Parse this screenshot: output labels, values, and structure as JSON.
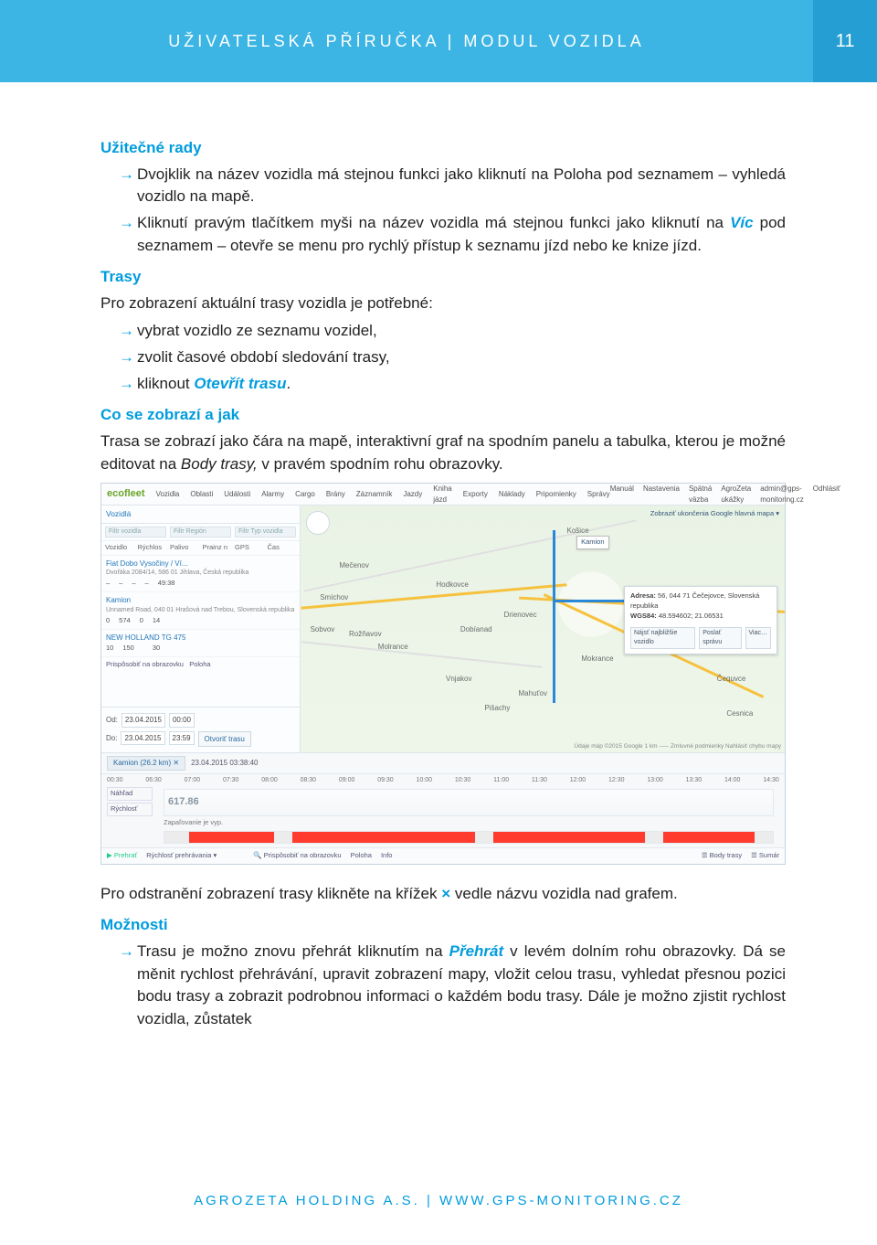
{
  "header": {
    "title": "UŽIVATELSKÁ PŘÍRUČKA | MODUL VOZIDLA",
    "page": "11"
  },
  "sec1": {
    "heading": "Užitečné rady",
    "items": [
      "Dvojklik na název vozidla má stejnou funkci jako kliknutí na Poloha pod seznamem – vyhledá vozidlo na mapě.",
      {
        "pre": "Kliknutí pravým tlačítkem myši na název vozidla má stejnou funkci jako kliknutí na ",
        "em": "Víc",
        "post": " pod seznamem – otevře se menu pro rychlý přístup k seznamu jízd nebo ke knize jízd."
      }
    ]
  },
  "sec2": {
    "heading": "Trasy",
    "intro": "Pro zobrazení aktuální trasy vozidla je potřebné:",
    "items": [
      "vybrat vozidlo ze seznamu vozidel,",
      "zvolit časové období sledování trasy,",
      {
        "pre": "kliknout ",
        "em": "Otevřít trasu",
        "post": "."
      }
    ]
  },
  "sec3": {
    "heading": "Co se zobrazí a jak",
    "para": {
      "pre": "Trasa se zobrazí jako čára na mapě, interaktivní graf na spodním panelu a tabulka, kterou je možné editovat na ",
      "em": "Body trasy,",
      "post": " v pravém spodním rohu obrazovky."
    }
  },
  "afterShot": {
    "pre": "Pro odstranění zobrazení trasy klikněte na křížek ",
    "x": "×",
    "post": " vedle názvu vozidla nad grafem."
  },
  "sec4": {
    "heading": "Možnosti",
    "items": [
      {
        "pre": "Trasu je možno znovu přehrát kliknutím na ",
        "em": "Přehrát",
        "post": " v levém dolním rohu obrazovky. Dá se měnit rychlost přehrávání, upravit zobrazení mapy, vložit celou trasu, vyhledat přesnou pozici bodu trasy a zobrazit podrobnou informaci o každém bodu trasy. Dále je možno zjistit rychlost vozidla, zůstatek"
      }
    ]
  },
  "footer": "AGROZETA HOLDING A.S. | WWW.GPS-MONITORING.CZ",
  "shot": {
    "logo": "ecofleet",
    "tools": [
      "Vozidla",
      "Oblasti",
      "Události",
      "Alarmy",
      "Cargo",
      "Brány",
      "Záznamník",
      "Jazdy",
      "Kniha jázd",
      "Exporty",
      "Náklady",
      "Pripomienky",
      "Správy"
    ],
    "right": [
      "Manuál",
      "Nastavenia",
      "Spätná väzba",
      "AgroZeta ukážky",
      "admin@gps-monitoring.cz",
      "Odhlásiť"
    ],
    "sideTitle": "Vozidlá",
    "filters": [
      "Filtr vozidla",
      "Filtr Región",
      "Filtr Typ vozidla"
    ],
    "cols": [
      "Vozidlo",
      "Rýchlos",
      "Palivo",
      "Prainz n",
      "GPS",
      "Čas"
    ],
    "rows": [
      {
        "name": "Fiat Dobo Vysočiny / Ví...",
        "sub": "Dvořáka 2084/14, 586 01 Jihlava, Česká republika",
        "nums": [
          "–",
          "–",
          "–",
          "–",
          "49:38"
        ]
      },
      {
        "name": "Kamion",
        "sub": "Unnamed Road, 040 01 Hrašová nad Trebou, Slovenská republika",
        "nums": [
          "0",
          "574",
          "0",
          "14",
          ""
        ]
      },
      {
        "name": "NEW HOLLAND TG 475",
        "sub": "",
        "nums": [
          "10",
          "150",
          "",
          "30",
          ""
        ]
      }
    ],
    "sideFit": "Prispôsobiť na obrazovku",
    "sidePoloha": "Poloha",
    "dateLabelFrom": "Od:",
    "dateLabelTo": "Do:",
    "dateFrom": "23.04.2015",
    "timeFrom": "00:00",
    "dateTo": "23.04.2015",
    "timeTo": "23:59",
    "openRoute": "Otvoriť trasu",
    "mapHeadRight": "Zobraziť ukončenia   Google hlavná mapa ▾",
    "pin": "Kamion",
    "towns": [
      "Košice",
      "Mečenov",
      "Smíchov",
      "Sobvov",
      "Rožňavov",
      "Molrance",
      "Vnjakov",
      "Pišachy",
      "Dobíanad",
      "Mahuťov",
      "Čequvce",
      "Cesnica",
      "Drienovec",
      "Hodkovce",
      "Mokrance"
    ],
    "popupAddrLabel": "Adresa:",
    "popupAddr": "56, 044 71 Čečejovce, Slovenská republika",
    "popupWgsLabel": "WGS84:",
    "popupWgs": "48.594602; 21.06531",
    "popupBtns": [
      "Nájsť najbližšie vozidlo",
      "Poslať správu",
      "Viac…"
    ],
    "mapFooter": "Údaje máp ©2015 Google   1 km ⸺   Zmluvné podmienky   Nahlásiť chybu mapy",
    "tlTab": "Kamion  (26.2 km) ✕",
    "tlDate": "23.04.2015 03:38:40",
    "tlHours": [
      "00:30",
      "06:30",
      "07:00",
      "07:30",
      "08:00",
      "08:30",
      "09:00",
      "09:30",
      "10:00",
      "10:30",
      "11:00",
      "11:30",
      "12:00",
      "12:30",
      "13:00",
      "13:30",
      "14:00",
      "14:30"
    ],
    "tlTabs": [
      "Náhľad",
      "Rýchlosť"
    ],
    "speed": "617.86",
    "redLabel": "Zapaľovanie je vyp.",
    "bottomLeft": [
      "Prehrať",
      "Rýchlosť prehrávania ▾"
    ],
    "bottomMid": [
      "Prispôsobiť na obrazovku",
      "Poloha",
      "Info"
    ],
    "bottomRight": [
      "Body trasy",
      "Sumár"
    ]
  }
}
